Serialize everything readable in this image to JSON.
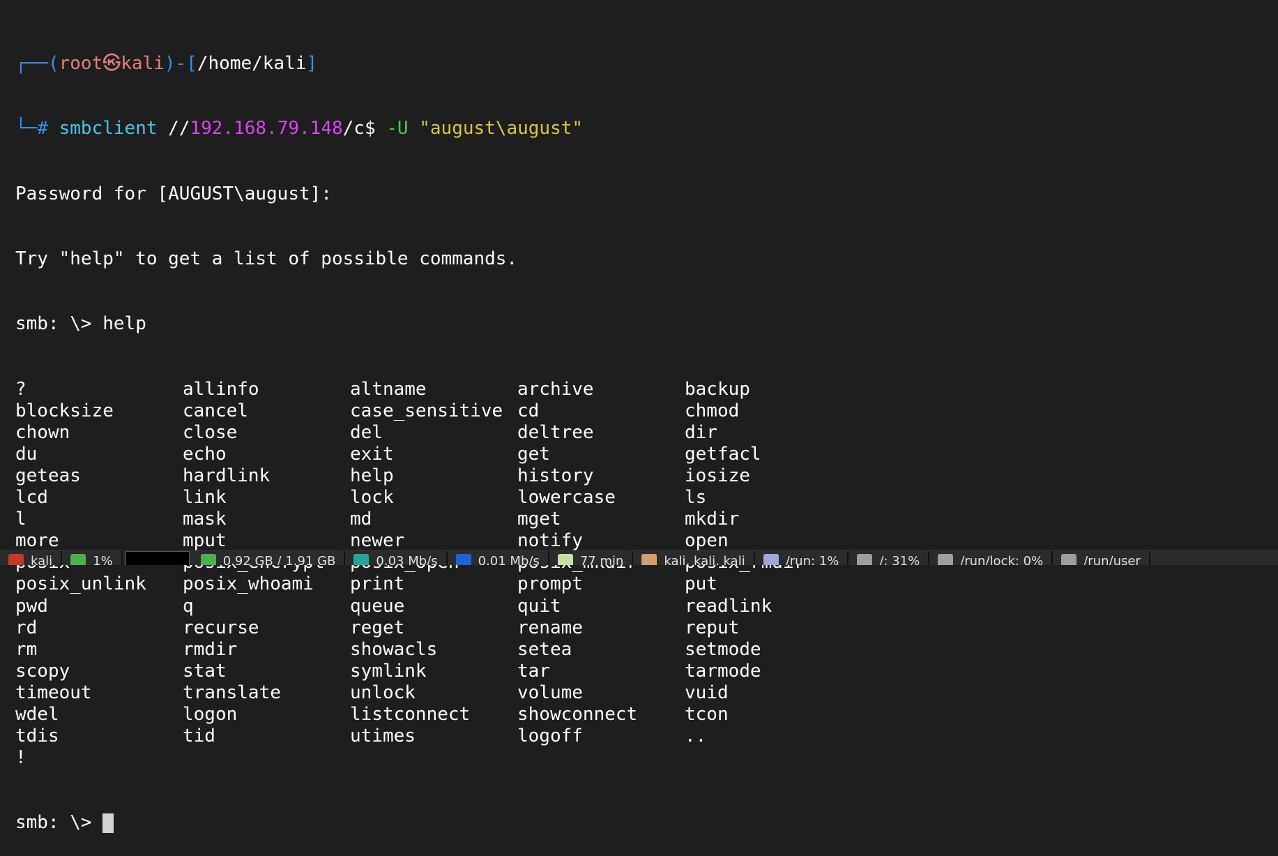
{
  "prompt": {
    "user": "root",
    "host_sym": "㉿",
    "host": "kali",
    "dir": "/home/kali",
    "hash": "#",
    "cmd": "smbclient",
    "path_prefix": "//",
    "ip": "192.168.79.148",
    "share": "/c$",
    "flag": "-U",
    "creds": "\"august\\august\""
  },
  "output": {
    "password_line": "Password for [AUGUST\\august]:",
    "hint_line": "Try \"help\" to get a list of possible commands.",
    "smb_prompt": "smb: \\>",
    "help_cmd": "help",
    "commands": [
      "?",
      "allinfo",
      "altname",
      "archive",
      "backup",
      "blocksize",
      "cancel",
      "case_sensitive",
      "cd",
      "chmod",
      "chown",
      "close",
      "del",
      "deltree",
      "dir",
      "du",
      "echo",
      "exit",
      "get",
      "getfacl",
      "geteas",
      "hardlink",
      "help",
      "history",
      "iosize",
      "lcd",
      "link",
      "lock",
      "lowercase",
      "ls",
      "l",
      "mask",
      "md",
      "mget",
      "mkdir",
      "more",
      "mput",
      "newer",
      "notify",
      "open",
      "posix",
      "posix_encrypt",
      "posix_open",
      "posix_mkdir",
      "posix_rmdir",
      "posix_unlink",
      "posix_whoami",
      "print",
      "prompt",
      "put",
      "pwd",
      "q",
      "queue",
      "quit",
      "readlink",
      "rd",
      "recurse",
      "reget",
      "rename",
      "reput",
      "rm",
      "rmdir",
      "showacls",
      "setea",
      "setmode",
      "scopy",
      "stat",
      "symlink",
      "tar",
      "tarmode",
      "timeout",
      "translate",
      "unlock",
      "volume",
      "vuid",
      "wdel",
      "logon",
      "listconnect",
      "showconnect",
      "tcon",
      "tdis",
      "tid",
      "utimes",
      "logoff",
      "..",
      "!"
    ],
    "final_prompt": "smb: \\>"
  },
  "panel": {
    "items": [
      {
        "icon": "kali-icon",
        "label": "kali",
        "color": "#c0392b"
      },
      {
        "icon": "cpu-icon",
        "label": "1%",
        "color": "#4caf50"
      },
      {
        "icon": "memory-icon",
        "label": "0.92 GB / 1.91 GB",
        "color": "#4caf50"
      },
      {
        "icon": "upload-icon",
        "label": "0.03 Mb/s",
        "color": "#26a69a"
      },
      {
        "icon": "download-icon",
        "label": "0.01 Mb/s",
        "color": "#1e63d6"
      },
      {
        "icon": "clock-icon",
        "label": "77 min",
        "color": "#c5e1a5"
      },
      {
        "icon": "user-icon",
        "label": "kali, kali, kali",
        "color": "#d0a070"
      },
      {
        "icon": "disk-icon",
        "label": "/run: 1%",
        "color": "#9fa8da"
      },
      {
        "icon": "disk-usage-icon",
        "label": "/: 31%",
        "color": "#9e9e9e"
      },
      {
        "icon": "disk-lock-icon",
        "label": "/run/lock: 0%",
        "color": "#9e9e9e"
      },
      {
        "icon": "disk-user-icon",
        "label": "/run/user",
        "color": "#9e9e9e"
      }
    ]
  }
}
